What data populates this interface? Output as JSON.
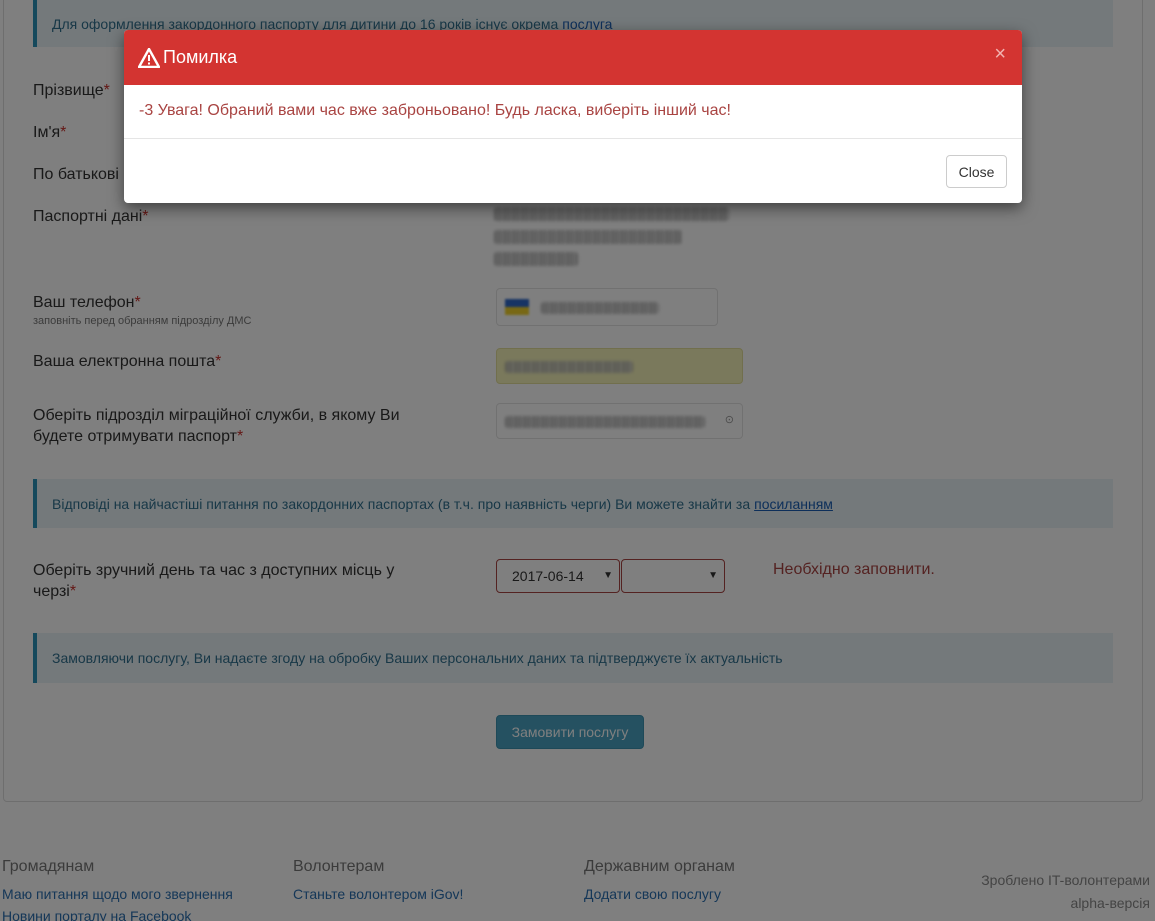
{
  "form": {
    "note_top": {
      "text": "Для оформлення закордонного паспорту для дитини до 16 років існує окрема",
      "link": "послуга"
    },
    "fields": {
      "surname": "Прізвище",
      "name": "Ім'я",
      "patronymic": "По батькові",
      "passport": "Паспортні дані",
      "phone": "Ваш телефон",
      "phone_hint": "заповніть перед обранням підрозділу ДМС",
      "email": "Ваша електронна пошта",
      "office": "Оберіть підрозділ міграційної служби, в якому Ви будете отримувати паспорт",
      "datetime": "Оберіть зручний день та час з доступних місць у черзі"
    },
    "required_mark": "*",
    "note_faq": {
      "text": "Відповіді на найчастіші питання по закордонних паспортах (в т.ч. про наявність черги) Ви можете знайти за",
      "link": "посиланням"
    },
    "date_select": "2017-06-14",
    "time_select": "",
    "error_text": "Необхідно заповнити.",
    "note_consent": "Замовляючи послугу, Ви надаєте згоду на обробку Ваших персональних даних та підтверджуєте їх актуальність",
    "submit_label": "Замовити послугу"
  },
  "footer": {
    "columns": [
      {
        "heading": "Громадянам",
        "links": [
          "Маю питання щодо мого звернення",
          "Новини порталу на Facebook"
        ]
      },
      {
        "heading": "Волонтерам",
        "links": [
          "Станьте волонтером iGov!"
        ]
      },
      {
        "heading": "Державним органам",
        "links": [
          "Додати свою послугу"
        ]
      }
    ],
    "made_by": "Зроблено IT-волонтерами",
    "version": "alpha-версія"
  },
  "modal": {
    "title": "Помилка",
    "close_x": "×",
    "message": "-3 Увага! Обраний вами час вже заброньовано! Будь ласка, виберіть інший час!",
    "close_button": "Close"
  },
  "colors": {
    "modal_header": "#d33431",
    "error_text": "#a94442",
    "note_bg": "#e8f2f7",
    "note_border": "#2a93b8",
    "link": "#2a6fb0",
    "submit_bg": "#4aa3c2"
  },
  "icons": {
    "modal_title": "warning-icon",
    "select_arrow": "caret-down-icon",
    "phone_flag": "flag-icon"
  }
}
